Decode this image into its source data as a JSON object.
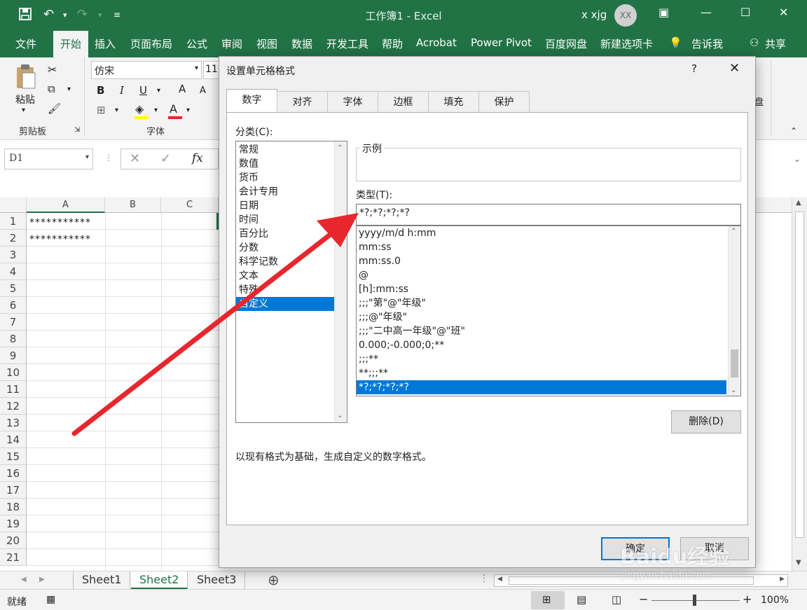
{
  "window": {
    "title": "工作簿1 - Excel",
    "user": "x xjg",
    "avatar": "XX"
  },
  "ribbon_tabs": [
    "文件",
    "开始",
    "插入",
    "页面布局",
    "公式",
    "审阅",
    "视图",
    "数据",
    "开发工具",
    "帮助",
    "Acrobat",
    "Power Pivot",
    "百度网盘",
    "新建选项卡",
    "告诉我",
    "共享"
  ],
  "ribbon": {
    "paste": "粘贴",
    "font_name": "仿宋",
    "font_size": "11",
    "clipboard_group": "剪贴板",
    "font_group": "字体",
    "bold": "B",
    "italic": "I",
    "underline": "U",
    "grow": "A",
    "shrink": "A",
    "fontcolor": "A"
  },
  "formula_bar": {
    "name_box": "D1",
    "fx": "fx"
  },
  "columns": [
    "A",
    "B",
    "C"
  ],
  "rows": [
    "1",
    "2",
    "3",
    "4",
    "5",
    "6",
    "7",
    "8",
    "9",
    "10",
    "11",
    "12",
    "13",
    "14",
    "15",
    "16",
    "17",
    "18",
    "19",
    "20",
    "21"
  ],
  "cells": {
    "A1": "***********",
    "A2": "***********"
  },
  "sheets": [
    "Sheet1",
    "Sheet2",
    "Sheet3"
  ],
  "active_sheet": "Sheet2",
  "status": {
    "ready": "就绪",
    "zoom": "100%"
  },
  "dialog": {
    "title": "设置单元格格式",
    "help": "?",
    "tabs": [
      "数字",
      "对齐",
      "字体",
      "边框",
      "填充",
      "保护"
    ],
    "category_label": "分类(C):",
    "categories": [
      "常规",
      "数值",
      "货币",
      "会计专用",
      "日期",
      "时间",
      "百分比",
      "分数",
      "科学记数",
      "文本",
      "特殊",
      "自定义"
    ],
    "selected_category": "自定义",
    "sample_label": "示例",
    "type_label": "类型(T):",
    "type_value": "*?;*?;*?;*?",
    "formats": [
      "yyyy/m/d h:mm",
      "mm:ss",
      "mm:ss.0",
      "@",
      "[h]:mm:ss",
      ";;;\"第\"@\"年级\"",
      ";;;@\"年级\"",
      ";;;\"二中高一年级\"@\"班\"",
      "0.000;-0.000;0;**",
      ";;;**",
      "**;;;**",
      "*?;*?;*?;*?"
    ],
    "selected_format": "*?;*?;*?;*?",
    "delete_button": "删除(D)",
    "description": "以现有格式为基础，生成自定义的数字格式。",
    "ok_button": "确定",
    "cancel_button": "取消"
  },
  "watermark": {
    "brand": "Baidu经验",
    "url": "jingyan.baidu.com"
  },
  "colors": {
    "excel_green": "#217346",
    "selection_blue": "#0078d7",
    "arrow_red": "#e8262d"
  }
}
